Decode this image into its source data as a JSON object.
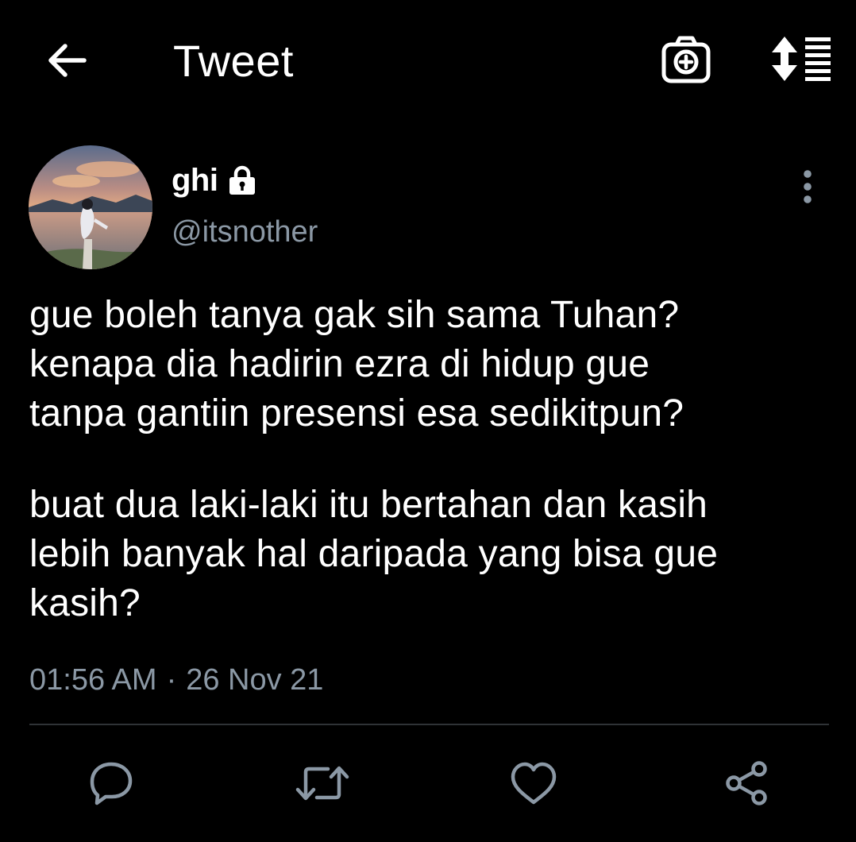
{
  "header": {
    "title": "Tweet",
    "back_icon": "arrow-left-icon",
    "camera_icon": "camera-plus-icon",
    "sort_icon": "sort-list-icon"
  },
  "author": {
    "display_name": "ghi",
    "handle": "@itsnother",
    "protected_icon": "lock-icon",
    "avatar_description_icon": "avatar-photo"
  },
  "tweet": {
    "paragraphs": [
      "gue boleh tanya gak sih sama Tuhan?\nkenapa dia hadirin ezra di hidup gue\ntanpa gantiin presensi esa sedikitpun?",
      "buat dua laki-laki itu bertahan dan kasih\nlebih banyak hal daripada yang bisa gue\nkasih?"
    ],
    "time": "01:56 AM",
    "separator": "·",
    "date": "26 Nov 21"
  },
  "actions": [
    {
      "name": "reply-button",
      "icon": "reply-icon"
    },
    {
      "name": "retweet-button",
      "icon": "retweet-icon"
    },
    {
      "name": "like-button",
      "icon": "heart-icon"
    },
    {
      "name": "share-button",
      "icon": "share-icon"
    }
  ],
  "colors": {
    "background": "#000000",
    "text_primary": "#ffffff",
    "text_secondary": "#8b98a5",
    "divider": "#2f3336"
  }
}
